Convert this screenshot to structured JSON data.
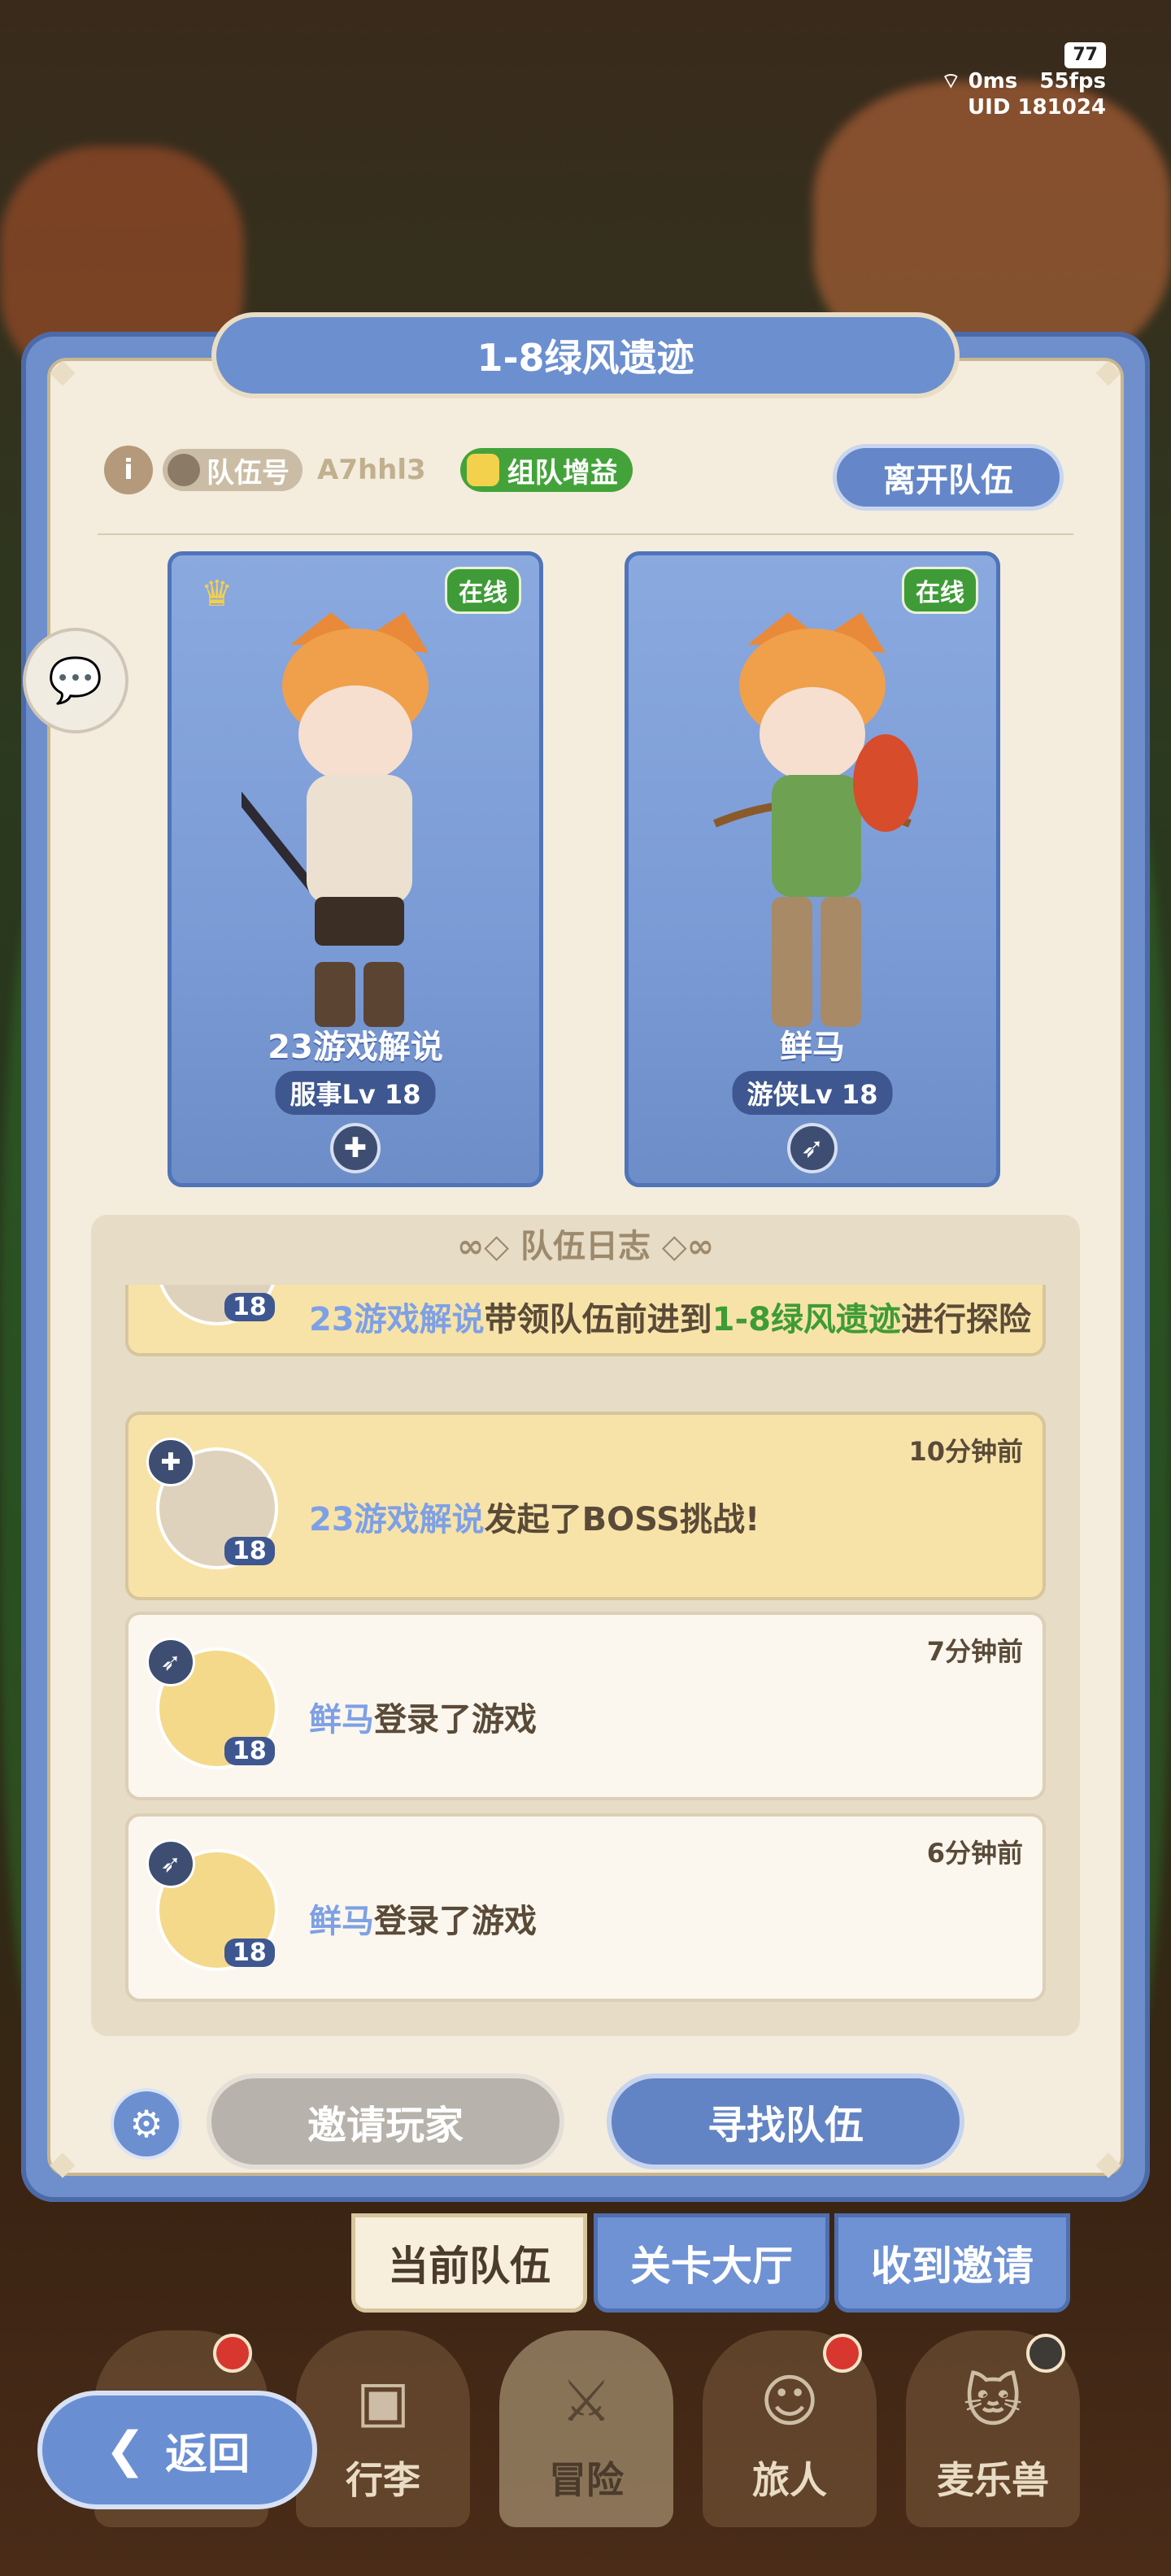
{
  "status": {
    "battery": "77",
    "ping": "0ms",
    "fps": "55fps",
    "uid": "UID 181024"
  },
  "header": {
    "title": "1-8绿风遗迹"
  },
  "team": {
    "id_label": "队伍号",
    "id_value": "A7hhl3",
    "buff_label": "组队增益",
    "leave_label": "离开队伍"
  },
  "members": [
    {
      "status": "在线",
      "name": "23游戏解说",
      "level": "服事Lv 18",
      "icon": "crosshair-cross-icon",
      "leader": true
    },
    {
      "status": "在线",
      "name": "鲜马",
      "level": "游侠Lv 18",
      "icon": "bow-icon",
      "leader": false
    }
  ],
  "log": {
    "title": "队伍日志",
    "entries": [
      {
        "who": "23游戏解说",
        "text_a": "带领队伍前进到",
        "stage": "1-8绿风遗迹",
        "text_b": "进行探险",
        "time": "",
        "level": "18"
      },
      {
        "who": "23游戏解说",
        "text_a": "发起了BOSS挑战!",
        "stage": "",
        "text_b": "",
        "time": "10分钟前",
        "level": "18"
      },
      {
        "who": "鲜马",
        "text_a": "登录了游戏",
        "stage": "",
        "text_b": "",
        "time": "7分钟前",
        "level": "18"
      },
      {
        "who": "鲜马",
        "text_a": "登录了游戏",
        "stage": "",
        "text_b": "",
        "time": "6分钟前",
        "level": "18"
      }
    ]
  },
  "actions": {
    "invite": "邀请玩家",
    "find": "寻找队伍"
  },
  "tabs": [
    {
      "label": "当前队伍"
    },
    {
      "label": "关卡大厅"
    },
    {
      "label": "收到邀请"
    }
  ],
  "nav": [
    {
      "label": "行李"
    },
    {
      "label": "冒险"
    },
    {
      "label": "旅人"
    },
    {
      "label": "麦乐兽"
    }
  ],
  "back": {
    "label": "返回"
  },
  "colors": {
    "accent": "#6c8fd0",
    "online": "#3f9b37",
    "player_name": "#7ea0e4",
    "stage_name": "#3e9c34"
  }
}
